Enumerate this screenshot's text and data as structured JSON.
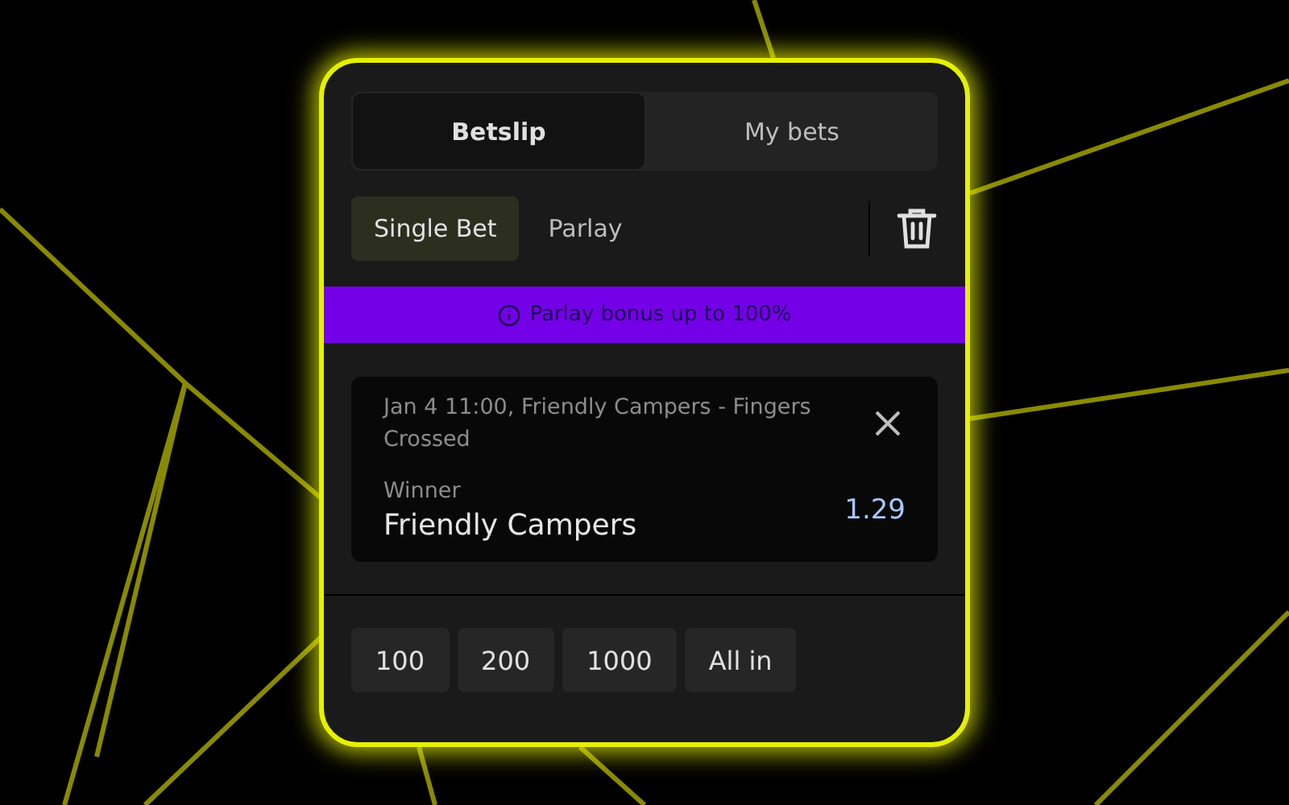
{
  "tabs": [
    {
      "label": "Betslip",
      "selected": true
    },
    {
      "label": "My bets",
      "selected": false
    }
  ],
  "bet_types": [
    {
      "label": "Single Bet",
      "selected": true
    },
    {
      "label": "Parlay",
      "selected": false
    }
  ],
  "banner": {
    "text": "Parlay bonus up to 100%"
  },
  "selection": {
    "event": "Jan 4 11:00, Friendly Campers - Fingers Crossed",
    "market": "Winner",
    "pick": "Friendly Campers",
    "odds": "1.29"
  },
  "stake_buttons": [
    "100",
    "200",
    "1000",
    "All in"
  ]
}
